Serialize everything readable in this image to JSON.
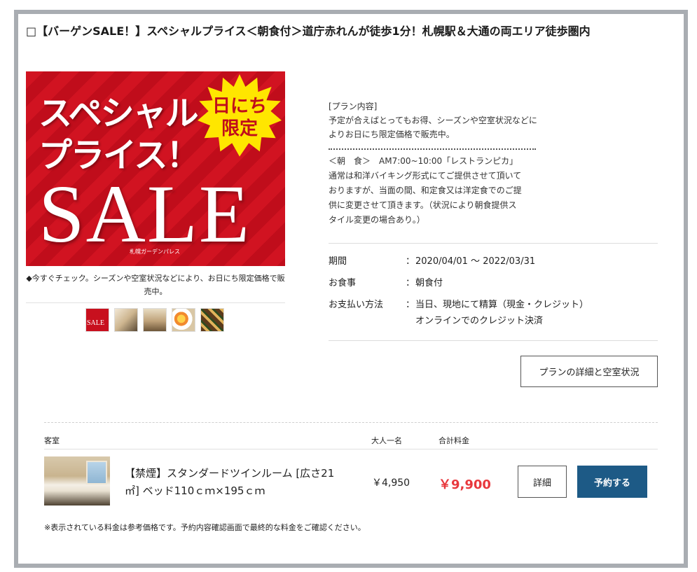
{
  "plan": {
    "title": "□【バーゲンSALE！】スペシャルプライス＜朝食付＞道庁赤れんが徒歩1分！札幌駅＆大通の両エリア徒歩圏内",
    "image": {
      "line1": "スペシャル",
      "line2": "プライス！",
      "sale": "SALE",
      "badge": "日にち限定",
      "hotel": "札幌ガーデンパレス"
    },
    "caption": "◆今すぐチェック。シーズンや空室状況などにより、お日にち限定価格で販売中。",
    "content": "[プラン内容]\n予定が合えばとってもお得、シーズンや空室状況などに\nよりお日にち限定価格で販売中。",
    "breakfast": "＜朝　食＞　AM7:00~10:00「レストランピカ」\n通常は和洋バイキング形式にてご提供させて頂いて\nおりますが、当面の間、和定食又は洋定食でのご提\n供に変更させて頂きます。（状況により朝食提供ス\nタイル変更の場合あり。）",
    "info": {
      "period_label": "期間",
      "period_value": "2020/04/01 ～ 2022/03/31",
      "meal_label": "お食事",
      "meal_value": "朝食付",
      "payment_label": "お支払い方法",
      "payment_value": "当日、現地にて精算（現金・クレジット）\nオンラインでのクレジット決済",
      "separator": "："
    },
    "detail_button": "プランの詳細と空室状況"
  },
  "table": {
    "col_room": "客室",
    "col_per_adult": "大人一名",
    "col_total": "合計料金"
  },
  "room": {
    "name": "【禁煙】スタンダードツインルーム [広さ21㎡] ベッド110ｃｍ×195ｃｍ",
    "per_adult": "￥4,950",
    "total": "￥9,900",
    "detail_button": "詳細",
    "reserve_button": "予約する"
  },
  "footnote": "※表示されている料金は参考価格です。予約内容確認画面で最終的な料金をご確認ください。",
  "colors": {
    "accent_red": "#e8383d",
    "reserve_blue": "#1d5a86",
    "sale_red": "#d11321",
    "badge_yellow": "#ffe600"
  }
}
